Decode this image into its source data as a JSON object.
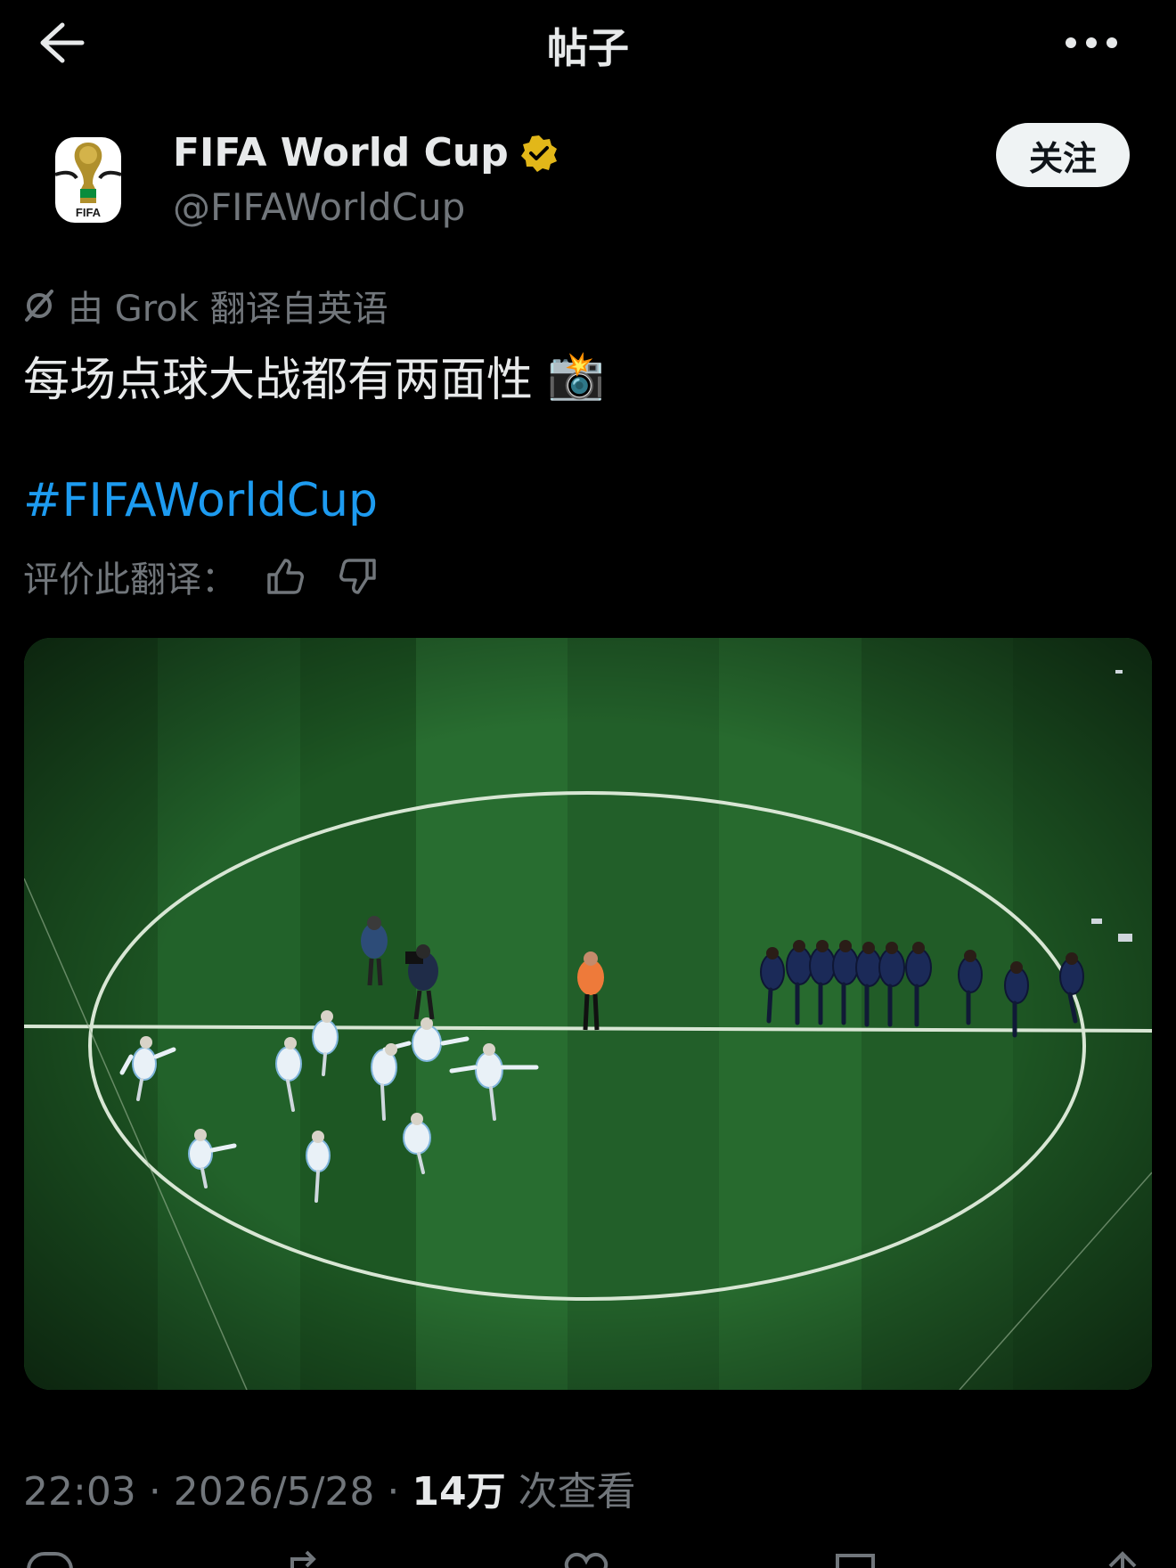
{
  "header": {
    "title": "帖子"
  },
  "author": {
    "name": "FIFA World Cup",
    "handle": "@FIFAWorldCup",
    "avatar_text": "FIFA",
    "follow_label": "关注",
    "verified_color": "#e2b719"
  },
  "post": {
    "translation_note": "由 Grok 翻译自英语",
    "text": "每场点球大战都有两面性",
    "emoji": "📸",
    "hashtag": "#FIFAWorldCup",
    "rate_label": "评价此翻译："
  },
  "meta": {
    "time": "22:03",
    "date": "2026/5/28",
    "views_count": "14万",
    "views_label": "次查看"
  },
  "colors": {
    "link": "#1d9bf0",
    "muted": "#71767b",
    "text": "#e7e9ea"
  }
}
